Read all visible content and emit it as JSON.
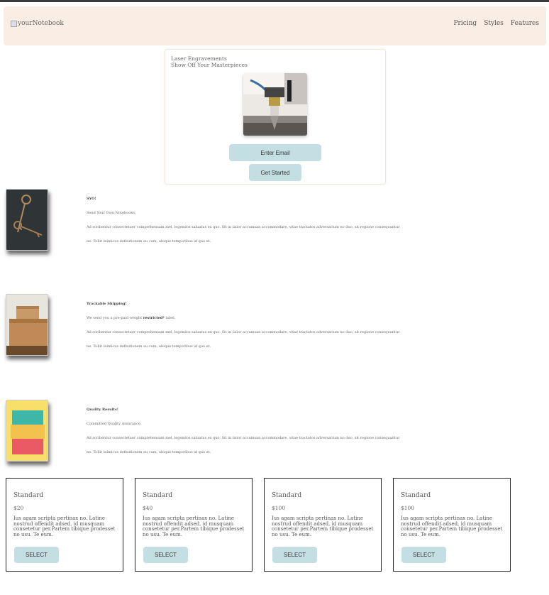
{
  "header": {
    "brand": "yourNotebook",
    "nav": [
      "Pricing",
      "Styles",
      "Features"
    ]
  },
  "hero": {
    "line1": "Laser Engravements",
    "line2": "Show Off Your Masterpieces",
    "email_button": "Enter Email",
    "start_button": "Get Started"
  },
  "features": [
    {
      "title": "SYO!",
      "subtitle": "Send Your Own Notebooks.",
      "body1": "Ad scribentur consectetuer comprehensam mel, legendos saluatus ex quo. Sit in iisior accumsan accommodare, vitae tractatos adversarium no duo, sit regione consequuntur",
      "body2": "ne. Tollit inimicus definitionem eu cum, ubique temporibus id quo et."
    },
    {
      "title": "Trackable Shipping!",
      "subtitle_prefix": "We send you a pre-paid weight",
      "subtitle_bold": "restricted*",
      "subtitle_suffix": "label.",
      "body1": "Ad scribentur consectetuer comprehensam mel, legendos saluatus ex quo. Sit in iisior accumsan accommodare, vitae tractatos adversarium no duo, sit regione consequuntur",
      "body2": "ne. Tollit inimicus definitionem eu cum, ubique temporibus id quo et."
    },
    {
      "title": "Quality Results!",
      "subtitle": "Committed Quality Assurance.",
      "body1": "Ad scribentur consectetuer comprehensam mel, legendos saluatus ex quo. Sit in iisior accumsan accommodare, vitae tractatos adversarium no duo, sit regione consequuntur",
      "body2": "ne. Tollit inimicus definitionem eu cum, ubique temporibus id quo et."
    }
  ],
  "plans": [
    {
      "title": "Standard",
      "price": "$20",
      "desc": "Ius agam scripta pertinax no. Latine nostrud offendit adsed, id musquam consetetur per.Partem tibique prodesset no usu. Te eum.",
      "button": "SELECT"
    },
    {
      "title": "Standard",
      "price": "$40",
      "desc": "Ius agam scripta pertinax no. Latine nostrud offendit adsed, id musquam consetetur per.Partem tibique prodesset no usu. Te eum.",
      "button": "SELECT"
    },
    {
      "title": "Standard",
      "price": "$100",
      "desc": "Ius agam scripta pertinax no. Latine nostrud offendit adsed, id musquam consetetur per.Partem tibique prodesset no usu. Te eum.",
      "button": "SELECT"
    },
    {
      "title": "Standard",
      "price": "$100",
      "desc": "Ius agam scripta pertinax no. Latine nostrud offendit adsed, id musquam consetetur per.Partem tibique prodesset no usu. Te eum.",
      "button": "SELECT"
    }
  ]
}
